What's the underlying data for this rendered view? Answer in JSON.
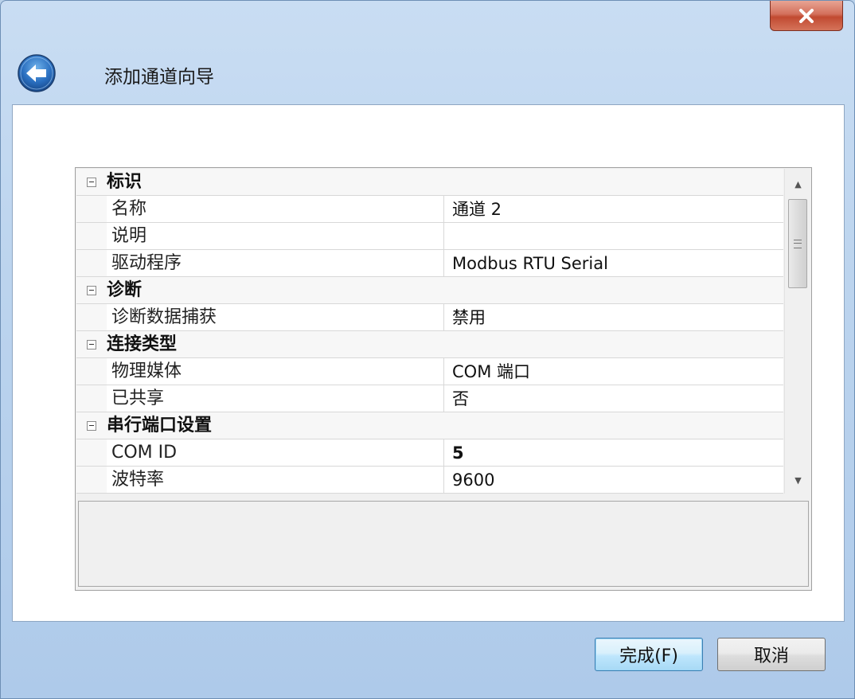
{
  "window": {
    "title": "添加通道向导",
    "close_symbol": "✕"
  },
  "properties": [
    {
      "type": "category",
      "label": "标识"
    },
    {
      "type": "prop",
      "name": "名称",
      "value": "通道 2"
    },
    {
      "type": "prop",
      "name": "说明",
      "value": ""
    },
    {
      "type": "prop",
      "name": "驱动程序",
      "value": "Modbus RTU Serial"
    },
    {
      "type": "category",
      "label": "诊断"
    },
    {
      "type": "prop",
      "name": "诊断数据捕获",
      "value": "禁用"
    },
    {
      "type": "category",
      "label": "连接类型"
    },
    {
      "type": "prop",
      "name": "物理媒体",
      "value": "COM 端口"
    },
    {
      "type": "prop",
      "name": "已共享",
      "value": "否"
    },
    {
      "type": "category",
      "label": "串行端口设置"
    },
    {
      "type": "prop",
      "name": "COM ID",
      "value": "5",
      "bold": true
    },
    {
      "type": "prop",
      "name": "波特率",
      "value": "9600"
    }
  ],
  "scrollbar": {
    "up_symbol": "▲",
    "down_symbol": "▼"
  },
  "buttons": {
    "finish": "完成(F)",
    "cancel": "取消"
  },
  "icons": {
    "close": "close-icon",
    "back": "back-arrow-icon",
    "expander": "minus-box-icon"
  }
}
